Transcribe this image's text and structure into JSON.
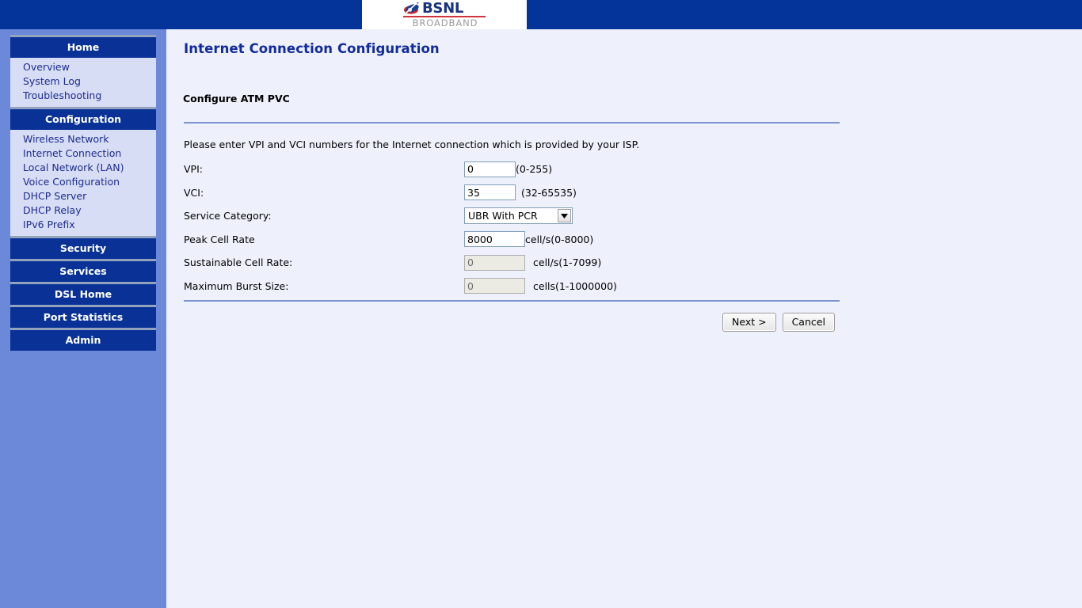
{
  "header": {
    "logo_text": "BSNL",
    "logo_sub": "BROADBAND",
    "logo_mark_icon": "bsnl-swoosh-icon"
  },
  "sidebar": {
    "groups": [
      {
        "title": "Home",
        "items": [
          "Overview",
          "System Log",
          "Troubleshooting"
        ]
      },
      {
        "title": "Configuration",
        "items": [
          "Wireless Network",
          "Internet Connection",
          "Local Network (LAN)",
          "Voice Configuration",
          "DHCP Server",
          "DHCP Relay",
          "IPv6 Prefix"
        ]
      },
      {
        "title": "Security",
        "items": []
      },
      {
        "title": "Services",
        "items": []
      },
      {
        "title": "DSL Home",
        "items": []
      },
      {
        "title": "Port Statistics",
        "items": []
      },
      {
        "title": "Admin",
        "items": []
      }
    ]
  },
  "main": {
    "page_title": "Internet Connection Configuration",
    "section_title": "Configure ATM PVC",
    "intro_text": "Please enter VPI and VCI numbers for the Internet connection which is provided by your ISP.",
    "fields": {
      "vpi": {
        "label": "VPI:",
        "value": "0",
        "hint": "(0-255)"
      },
      "vci": {
        "label": "VCI:",
        "value": "35",
        "hint": "(32-65535)"
      },
      "service_category": {
        "label": "Service Category:",
        "value": "UBR With PCR"
      },
      "peak_cell_rate": {
        "label": "Peak Cell Rate",
        "value": "8000",
        "hint": "cell/s(0-8000)"
      },
      "sustainable_cell_rate": {
        "label": "Sustainable Cell Rate:",
        "value": "0",
        "hint": "cell/s(1-7099)"
      },
      "maximum_burst_size": {
        "label": "Maximum Burst Size:",
        "value": "0",
        "hint": "cells(1-1000000)"
      }
    },
    "buttons": {
      "next": "Next >",
      "cancel": "Cancel"
    }
  },
  "colors": {
    "header_blue": "#043399",
    "sidebar_blue": "#6b89d8",
    "menu_head_blue": "#0a3296",
    "menu_item_bg": "#d6ddf4",
    "content_bg": "#eef1fb",
    "title_blue": "#122a9b",
    "rule_blue": "#7b93d0",
    "logo_red": "#d0333c"
  }
}
